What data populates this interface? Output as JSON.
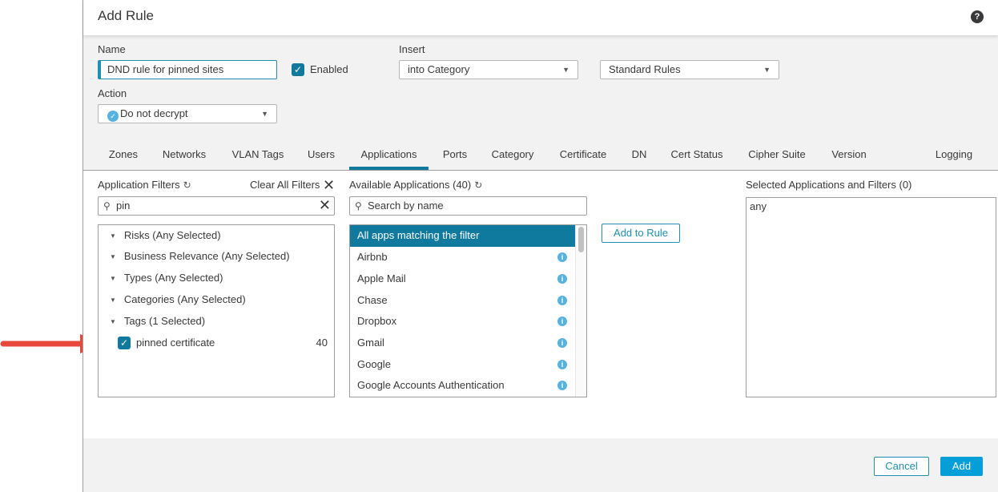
{
  "dialog": {
    "title": "Add Rule",
    "help_icon": "question-circle-icon"
  },
  "form": {
    "name_label": "Name",
    "name_value": "DND rule for pinned sites",
    "enabled_label": "Enabled",
    "enabled_checked": true,
    "insert_label": "Insert",
    "insert_position": "into Category",
    "insert_category": "Standard Rules",
    "action_label": "Action",
    "action_value": "Do not decrypt"
  },
  "tabs": [
    {
      "label": "Zones"
    },
    {
      "label": "Networks"
    },
    {
      "label": "VLAN Tags"
    },
    {
      "label": "Users"
    },
    {
      "label": "Applications",
      "active": true
    },
    {
      "label": "Ports"
    },
    {
      "label": "Category"
    },
    {
      "label": "Certificate"
    },
    {
      "label": "DN"
    },
    {
      "label": "Cert Status"
    },
    {
      "label": "Cipher Suite"
    },
    {
      "label": "Version"
    },
    {
      "label": "Logging"
    }
  ],
  "filters": {
    "title": "Application Filters",
    "clear_all": "Clear All Filters",
    "search_value": "pin",
    "groups": [
      {
        "label": "Risks (Any Selected)"
      },
      {
        "label": "Business Relevance (Any Selected)"
      },
      {
        "label": "Types (Any Selected)"
      },
      {
        "label": "Categories (Any Selected)"
      },
      {
        "label": "Tags (1 Selected)"
      }
    ],
    "tag_item": {
      "label": "pinned certificate",
      "count": "40",
      "checked": true
    }
  },
  "available": {
    "title": "Available Applications (40)",
    "search_placeholder": "Search by name",
    "items": [
      {
        "label": "All apps matching the filter",
        "selected": true
      },
      {
        "label": "Airbnb"
      },
      {
        "label": "Apple Mail"
      },
      {
        "label": "Chase"
      },
      {
        "label": "Dropbox"
      },
      {
        "label": "Gmail"
      },
      {
        "label": "Google"
      },
      {
        "label": "Google Accounts Authentication"
      }
    ],
    "add_to_rule": "Add to Rule"
  },
  "selected": {
    "title": "Selected Applications and Filters (0)",
    "value": "any"
  },
  "footer": {
    "cancel": "Cancel",
    "add": "Add"
  },
  "colors": {
    "accent": "#0f7a9e",
    "primary_button": "#049fd9",
    "annotation_arrow": "#e8473b"
  }
}
